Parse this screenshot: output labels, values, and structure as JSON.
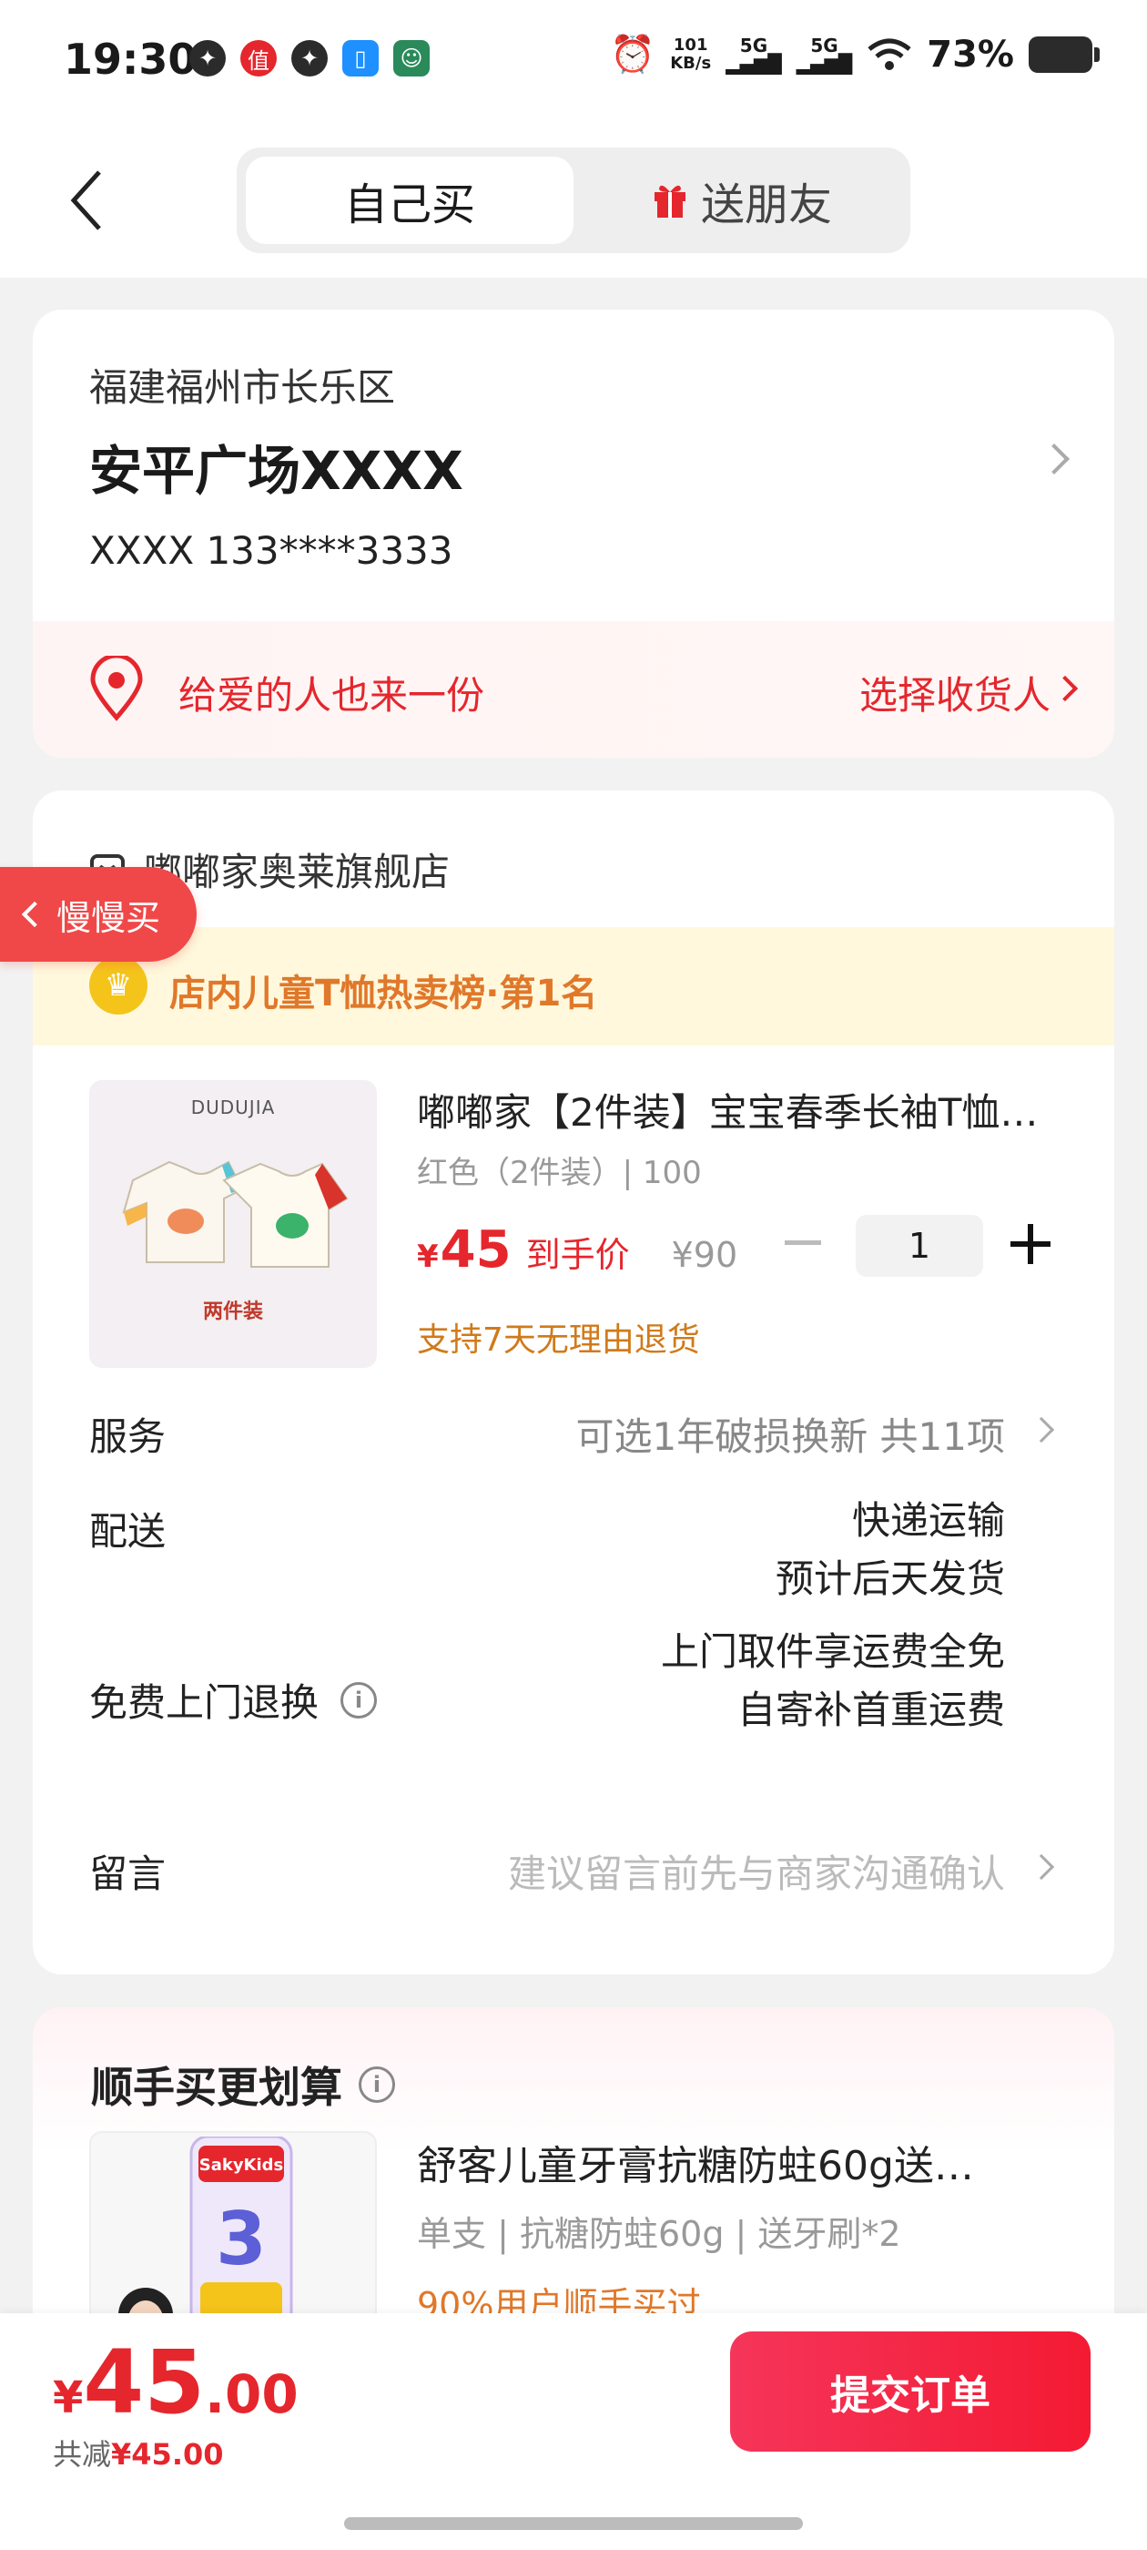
{
  "status_bar": {
    "time": "19:30",
    "net_speed_value": "101",
    "net_speed_unit": "KB/s",
    "signal_1": "5G",
    "signal_2": "5G",
    "battery": "73%"
  },
  "header": {
    "tab_self": "自己买",
    "tab_gift": "送朋友"
  },
  "address": {
    "region": "福建福州市长乐区",
    "street": "安平广场XXXX",
    "contact": "XXXX  133****3333",
    "gift_prompt": "给爱的人也来一份",
    "choose_recipient": "选择收货人"
  },
  "floating": {
    "slow_buy": "慢慢买"
  },
  "order": {
    "store_name": "嘟嘟家奥莱旗舰店",
    "rank_banner": "店内儿童T恤热卖榜·第1名",
    "product": {
      "image_brand": "DUDUJIA",
      "image_caption": "两件装",
      "title": "嘟嘟家【2件装】宝宝春季长袖T恤…",
      "spec": "红色（2件装）| 100",
      "price_symbol": "¥",
      "price": "45",
      "price_label": "到手价",
      "original_price": "¥90",
      "quantity": "1",
      "return_policy": "支持7天无理由退货"
    },
    "rows": {
      "service_label": "服务",
      "service_value": "可选1年破损换新 共11项",
      "delivery_label": "配送",
      "delivery_line1": "快递运输",
      "delivery_line2": "预计后天发货",
      "return_label": "免费上门退换",
      "return_line1": "上门取件享运费全免",
      "return_line2": "自寄补首重运费",
      "message_label": "留言",
      "message_placeholder": "建议留言前先与商家沟通确认"
    }
  },
  "upsell": {
    "title": "顺手买更划算",
    "image_brand": "SakyKids",
    "product_name": "舒客儿童牙膏抗糖防蛀60g送…",
    "spec": "单支 | 抗糖防蛀60g | 送牙刷*2",
    "social_proof": "90%用户顺手买过"
  },
  "bottom": {
    "total_symbol": "¥",
    "total_int": "45",
    "total_dec": ".00",
    "savings_label": "共减",
    "savings_amount": "¥45.00",
    "submit": "提交订单"
  },
  "colors": {
    "accent_red": "#e5262d",
    "orange": "#e0782a",
    "banner_yellow": "#fff8dc"
  }
}
